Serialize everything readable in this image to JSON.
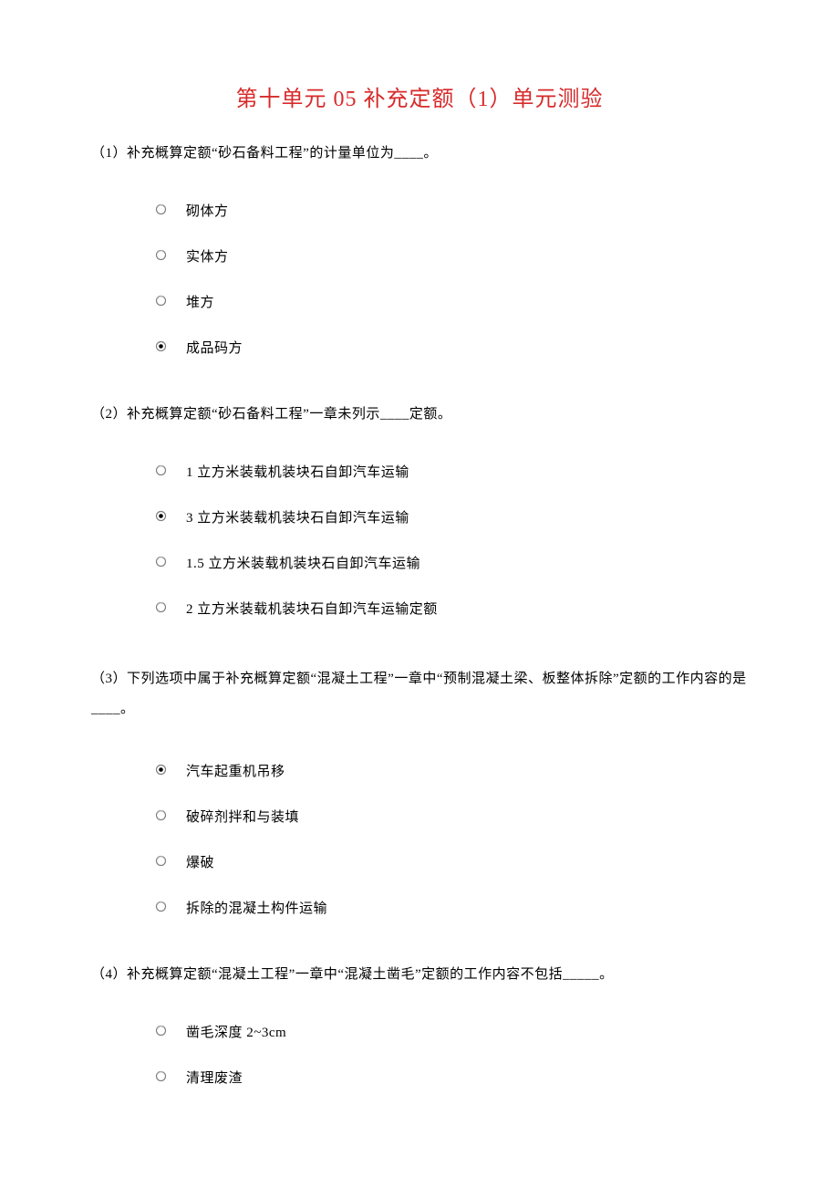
{
  "title": "第十单元 05 补充定额（1）单元测验",
  "questions": [
    {
      "number": "（1）",
      "text": "补充概算定额“砂石备料工程”的计量单位为____。",
      "options": [
        {
          "label": "砌体方",
          "selected": false
        },
        {
          "label": "实体方",
          "selected": false
        },
        {
          "label": "堆方",
          "selected": false
        },
        {
          "label": "成品码方",
          "selected": true
        }
      ]
    },
    {
      "number": "（2）",
      "text": "补充概算定额“砂石备料工程”一章未列示____定额。",
      "options": [
        {
          "label": "1 立方米装载机装块石自卸汽车运输",
          "selected": false
        },
        {
          "label": "3 立方米装载机装块石自卸汽车运输",
          "selected": true
        },
        {
          "label": "1.5 立方米装载机装块石自卸汽车运输",
          "selected": false
        },
        {
          "label": "2 立方米装载机装块石自卸汽车运输定额",
          "selected": false
        }
      ]
    },
    {
      "number": "（3）",
      "text": "下列选项中属于补充概算定额“混凝土工程”一章中“预制混凝土梁、板整体拆除”定额的工作内容的是____。",
      "options": [
        {
          "label": "汽车起重机吊移",
          "selected": true
        },
        {
          "label": "破碎剂拌和与装填",
          "selected": false
        },
        {
          "label": "爆破",
          "selected": false
        },
        {
          "label": "拆除的混凝土构件运输",
          "selected": false
        }
      ]
    },
    {
      "number": "（4）",
      "text": "补充概算定额“混凝土工程”一章中“混凝土凿毛”定额的工作内容不包括_____。",
      "options": [
        {
          "label": "凿毛深度 2~3cm",
          "selected": false
        },
        {
          "label": "清理废渣",
          "selected": false
        }
      ]
    }
  ]
}
